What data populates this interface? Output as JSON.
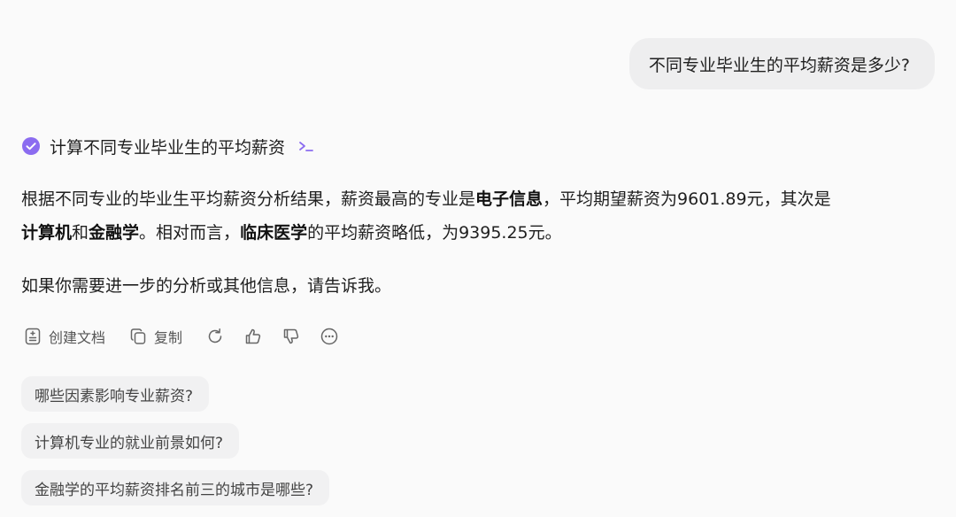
{
  "user_message": "不同专业毕业生的平均薪资是多少?",
  "tool_step": {
    "label": "计算不同专业毕业生的平均薪资",
    "status_icon": "check-circle-icon",
    "code_icon": "terminal-icon",
    "accent_color": "#8b6cf0"
  },
  "answer": {
    "p1_a": "根据不同专业的毕业生平均薪资分析结果，薪资最高的专业是",
    "p1_b": "电子信息",
    "p1_c": "，平均期望薪资为9601.89元，其次是",
    "p1_d": "计算机",
    "p1_e": "和",
    "p1_f": "金融学",
    "p1_g": "。相对而言，",
    "p1_h": "临床医学",
    "p1_i": "的平均薪资略低，为9395.25元。",
    "p2": "如果你需要进一步的分析或其他信息，请告诉我。"
  },
  "actions": {
    "create_doc": "创建文档",
    "copy": "复制"
  },
  "suggestions": [
    "哪些因素影响专业薪资?",
    "计算机专业的就业前景如何?",
    "金融学的平均薪资排名前三的城市是哪些?"
  ]
}
